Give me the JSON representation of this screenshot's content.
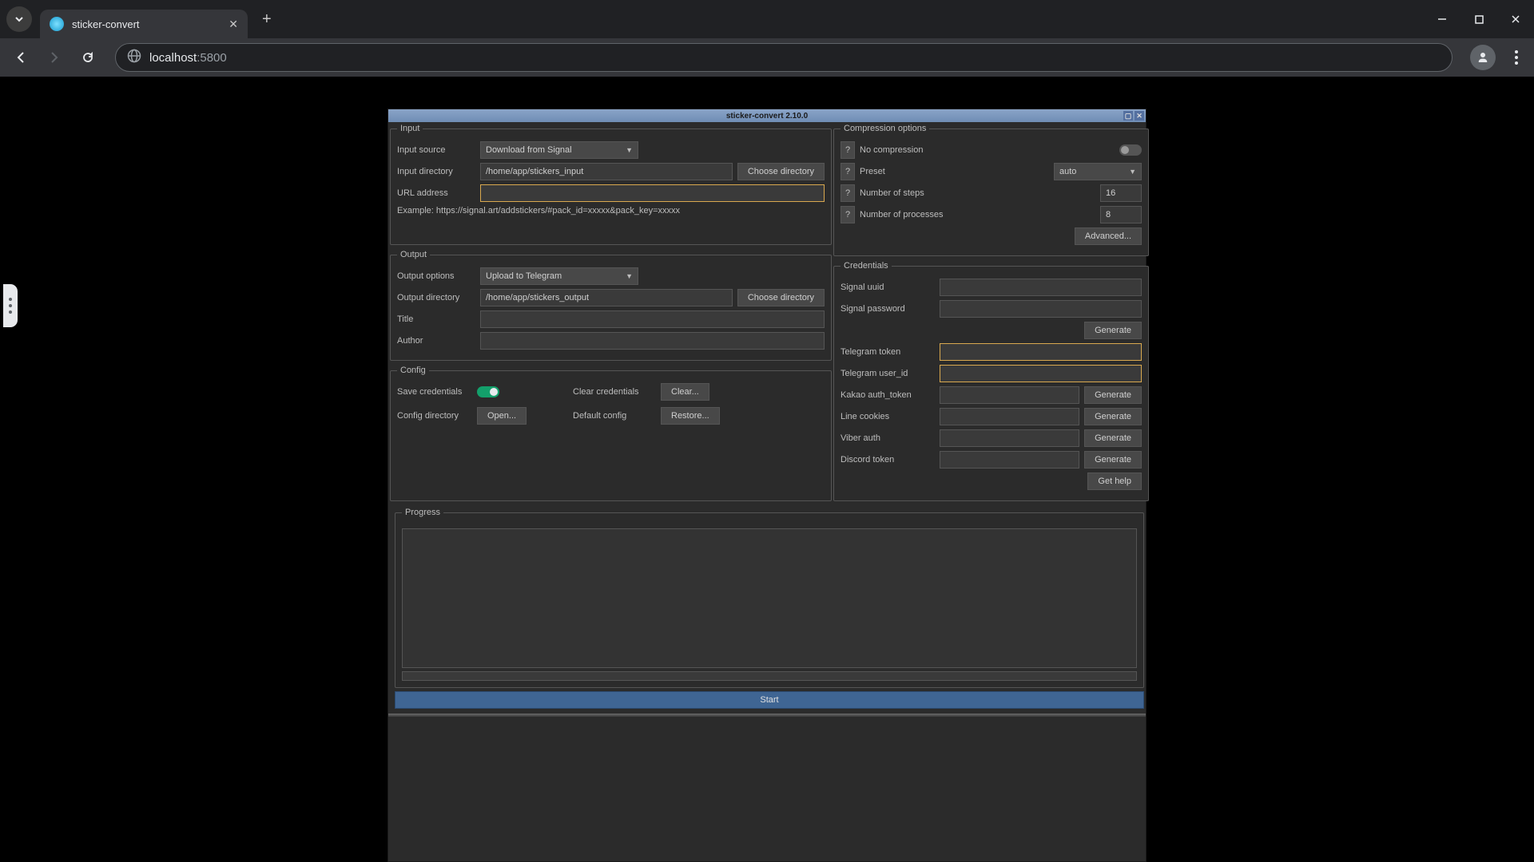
{
  "browser": {
    "tab_title": "sticker-convert",
    "url_host": "localhost",
    "url_port": ":5800"
  },
  "app": {
    "title": "sticker-convert 2.10.0"
  },
  "input": {
    "legend": "Input",
    "source_label": "Input source",
    "source_value": "Download from Signal",
    "dir_label": "Input directory",
    "dir_value": "/home/app/stickers_input",
    "choose_dir": "Choose directory",
    "url_label": "URL address",
    "url_value": "",
    "example": "Example: https://signal.art/addstickers/#pack_id=xxxxx&pack_key=xxxxx"
  },
  "output": {
    "legend": "Output",
    "options_label": "Output options",
    "options_value": "Upload to Telegram",
    "dir_label": "Output directory",
    "dir_value": "/home/app/stickers_output",
    "choose_dir": "Choose directory",
    "title_label": "Title",
    "title_value": "",
    "author_label": "Author",
    "author_value": ""
  },
  "config": {
    "legend": "Config",
    "save_label": "Save credentials",
    "save_on": true,
    "clear_label": "Clear credentials",
    "clear_btn": "Clear...",
    "dir_label": "Config directory",
    "open_btn": "Open...",
    "default_label": "Default config",
    "restore_btn": "Restore..."
  },
  "compression": {
    "legend": "Compression options",
    "no_label": "No compression",
    "no_on": false,
    "preset_label": "Preset",
    "preset_value": "auto",
    "steps_label": "Number of steps",
    "steps_value": "16",
    "procs_label": "Number of processes",
    "procs_value": "8",
    "advanced": "Advanced...",
    "help": "?"
  },
  "credentials": {
    "legend": "Credentials",
    "signal_uuid_label": "Signal uuid",
    "signal_password_label": "Signal password",
    "generate": "Generate",
    "telegram_token_label": "Telegram token",
    "telegram_userid_label": "Telegram user_id",
    "kakao_label": "Kakao auth_token",
    "line_label": "Line cookies",
    "viber_label": "Viber auth",
    "discord_label": "Discord token",
    "get_help": "Get help"
  },
  "progress": {
    "legend": "Progress"
  },
  "start_label": "Start"
}
